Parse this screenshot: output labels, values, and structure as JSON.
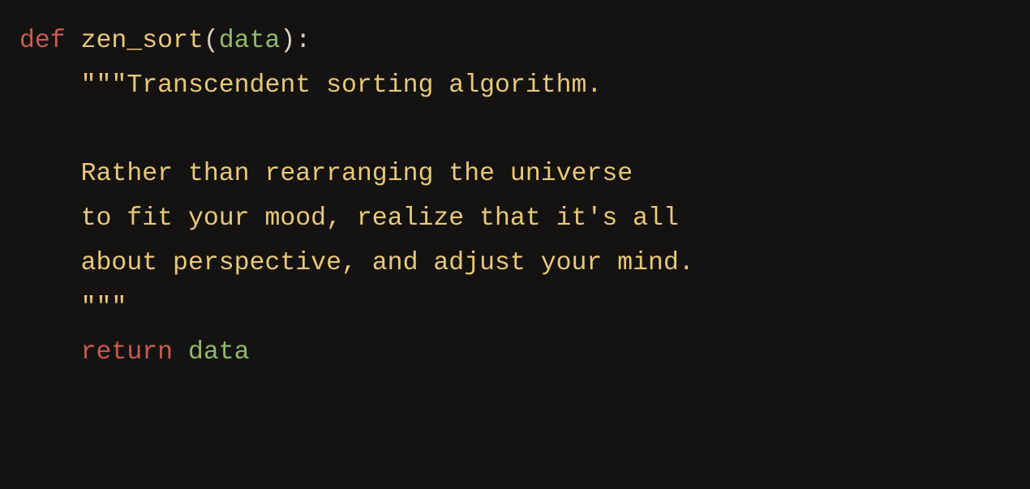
{
  "code": {
    "line1": {
      "def": "def",
      "space1": " ",
      "fname": "zen_sort",
      "lparen": "(",
      "param": "data",
      "rparen": ")",
      "colon": ":"
    },
    "line2": {
      "indent": "    ",
      "text": "\"\"\"Transcendent sorting algorithm."
    },
    "line3": "",
    "line4": {
      "indent": "    ",
      "text": "Rather than rearranging the universe"
    },
    "line5": {
      "indent": "    ",
      "text": "to fit your mood, realize that it's all"
    },
    "line6": {
      "indent": "    ",
      "text": "about perspective, and adjust your mind."
    },
    "line7": {
      "indent": "    ",
      "text": "\"\"\""
    },
    "line8": {
      "indent": "    ",
      "ret": "return",
      "space": " ",
      "var": "data"
    }
  }
}
